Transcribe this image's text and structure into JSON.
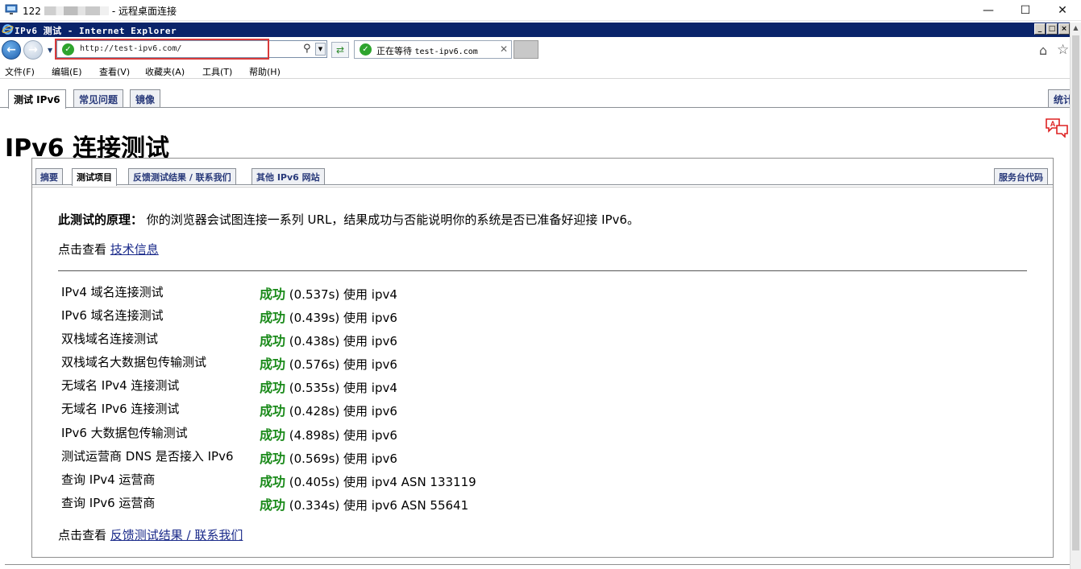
{
  "remote_desktop": {
    "title_prefix": "122",
    "title_suffix": "- 远程桌面连接",
    "controls": [
      "—",
      "☐",
      "✕"
    ]
  },
  "ie": {
    "window_title": "IPv6 测试 - Internet Explorer",
    "window_buttons": [
      "_",
      "□",
      "×"
    ],
    "address_url": "http://test-ipv6.com/",
    "tab_label_status": "正在等待",
    "tab_label_host": "test-ipv6.com",
    "menu": [
      "文件(F)",
      "编辑(E)",
      "查看(V)",
      "收藏夹(A)",
      "工具(T)",
      "帮助(H)"
    ]
  },
  "page": {
    "top_tabs": [
      "测试 IPv6",
      "常见问题",
      "镜像"
    ],
    "top_tab_right": "统计",
    "title": "IPv6 连接测试",
    "inner_tabs": [
      "摘要",
      "测试项目",
      "反馈测试结果 / 联系我们",
      "其他 IPv6 网站"
    ],
    "inner_tab_right": "服务台代码",
    "principle_label": "此测试的原理：",
    "principle_text": " 你的浏览器会试图连接一系列 URL，结果成功与否能说明你的系统是否已准备好迎接 IPv6。",
    "tech_prefix": "点击查看 ",
    "tech_link": "技术信息",
    "feedback_prefix": "点击查看 ",
    "feedback_link": "反馈测试结果 / 联系我们",
    "results": [
      {
        "name": "IPv4 域名连接测试",
        "status": "成功",
        "detail": " (0.537s) 使用 ipv4"
      },
      {
        "name": "IPv6 域名连接测试",
        "status": "成功",
        "detail": " (0.439s) 使用 ipv6"
      },
      {
        "name": "双栈域名连接测试",
        "status": "成功",
        "detail": " (0.438s) 使用 ipv6"
      },
      {
        "name": "双栈域名大数据包传输测试",
        "status": "成功",
        "detail": " (0.576s) 使用 ipv6"
      },
      {
        "name": "无域名 IPv4 连接测试",
        "status": "成功",
        "detail": " (0.535s) 使用 ipv4"
      },
      {
        "name": "无域名 IPv6 连接测试",
        "status": "成功",
        "detail": " (0.428s) 使用 ipv6"
      },
      {
        "name": "IPv6 大数据包传输测试",
        "status": "成功",
        "detail": " (4.898s) 使用 ipv6"
      },
      {
        "name": "测试运营商 DNS 是否接入 IPv6",
        "status": "成功",
        "detail": " (0.569s) 使用 ipv6"
      },
      {
        "name": "查询 IPv4 运营商",
        "status": "成功",
        "detail": " (0.405s) 使用 ipv4 ASN 133119"
      },
      {
        "name": "查询 IPv6 运营商",
        "status": "成功",
        "detail": " (0.334s) 使用 ipv6 ASN 55641"
      }
    ]
  },
  "colors": {
    "success": "#1a8a1a",
    "link": "#1a2a8a",
    "ie_titlebar": "#0a246a",
    "highlight_box": "#d93a3a"
  }
}
